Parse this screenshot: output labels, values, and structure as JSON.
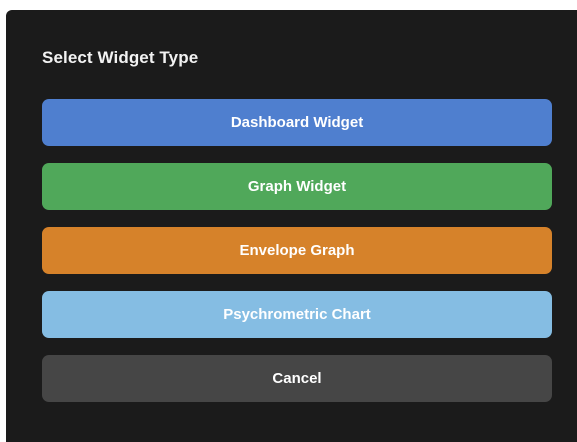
{
  "dialog": {
    "title": "Select Widget Type",
    "background_color": "#1b1b1b",
    "options": [
      {
        "label": "Dashboard Widget",
        "color": "#4f7fcf"
      },
      {
        "label": "Graph Widget",
        "color": "#50a85a"
      },
      {
        "label": "Envelope Graph",
        "color": "#d6822a"
      },
      {
        "label": "Psychrometric Chart",
        "color": "#85bde3"
      }
    ],
    "cancel": {
      "label": "Cancel",
      "color": "#464646"
    }
  }
}
